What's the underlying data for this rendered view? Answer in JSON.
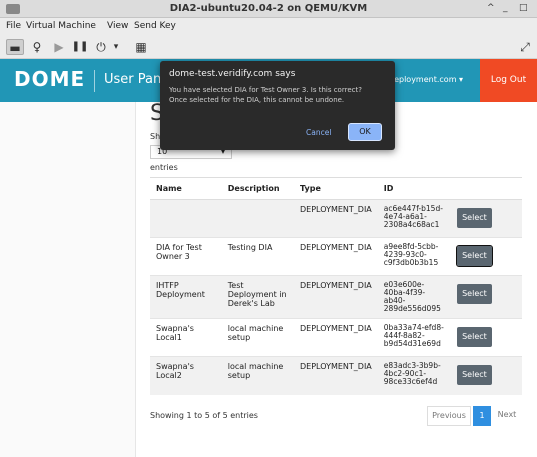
{
  "window": {
    "title": "DIA2-ubuntu20.04-2 on QEMU/KVM",
    "controls": [
      "^",
      "_",
      "□"
    ]
  },
  "menubar": {
    "items": [
      "File",
      "Virtual Machine",
      "View",
      "Send Key"
    ]
  },
  "toolbar": {
    "icons": [
      "screen-icon",
      "lightbulb-icon",
      "play-icon",
      "pause-icon",
      "power-icon",
      "dropdown-icon",
      "snapshot-icon",
      "fullscreen-icon"
    ],
    "glyphs": {
      "screen": "▬",
      "bulb": "♀",
      "play": "▶",
      "pause": "❚❚",
      "power": "⏻",
      "caret": "▾",
      "snap": "▦",
      "full": "⤢"
    }
  },
  "app": {
    "logo": "DOME",
    "nav_title": "User Pane",
    "deployment_dropdown": "deployment.com ▾",
    "logout": "Log Out",
    "heading": "S",
    "show_label": "Sh",
    "entries_value": "10",
    "entries_caret": "▾",
    "entries_label": "entries",
    "table": {
      "headers": [
        "Name",
        "Description",
        "Type",
        "ID",
        ""
      ],
      "rows": [
        {
          "name": "",
          "description": "",
          "type": "DEPLOYMENT_DIA",
          "id": [
            "ac6e447f-b15d-",
            "4e74-a6a1-",
            "2308a4c68ac1"
          ],
          "action": "Select"
        },
        {
          "name": "DIA for Test Owner 3",
          "description": "Testing DIA",
          "type": "DEPLOYMENT_DIA",
          "id": [
            "a9ee8fd-5cbb-",
            "4239-93c0-",
            "c9f3db0b3b15"
          ],
          "action": "Select"
        },
        {
          "name": "IHTFP Deployment",
          "description": "Test Deployment in Derek's Lab",
          "type": "DEPLOYMENT_DIA",
          "id": [
            "e03e600e-",
            "40ba-4f39-",
            "ab40-",
            "289de556d095"
          ],
          "action": "Select"
        },
        {
          "name": "Swapna's Local1",
          "description": "local machine setup",
          "type": "DEPLOYMENT_DIA",
          "id": [
            "0ba33a74-efd8-",
            "444f-8a82-",
            "b9d54d31e69d"
          ],
          "action": "Select"
        },
        {
          "name": "Swapna's Local2",
          "description": "local machine setup",
          "type": "DEPLOYMENT_DIA",
          "id": [
            "e83adc3-3b9b-",
            "4bc2-90c1-",
            "98ce33c6ef4d"
          ],
          "action": "Select"
        }
      ]
    },
    "showing": "Showing 1 to 5 of 5 entries",
    "pagination": {
      "previous": "Previous",
      "current": "1",
      "next": "Next"
    }
  },
  "dialog": {
    "title": "dome-test.veridify.com says",
    "message_line1": "You have selected DIA for Test Owner 3. Is this correct?",
    "message_line2": "Once selected for the DIA, this cannot be undone.",
    "cancel": "Cancel",
    "ok": "OK"
  },
  "colors": {
    "navbar": "#2196b6",
    "logout": "#f04a24",
    "dialog_bg": "#2a2a2a",
    "dialog_accent": "#8ab4f8",
    "select_button": "#5a6670",
    "pager_active": "#2f8fe0"
  }
}
